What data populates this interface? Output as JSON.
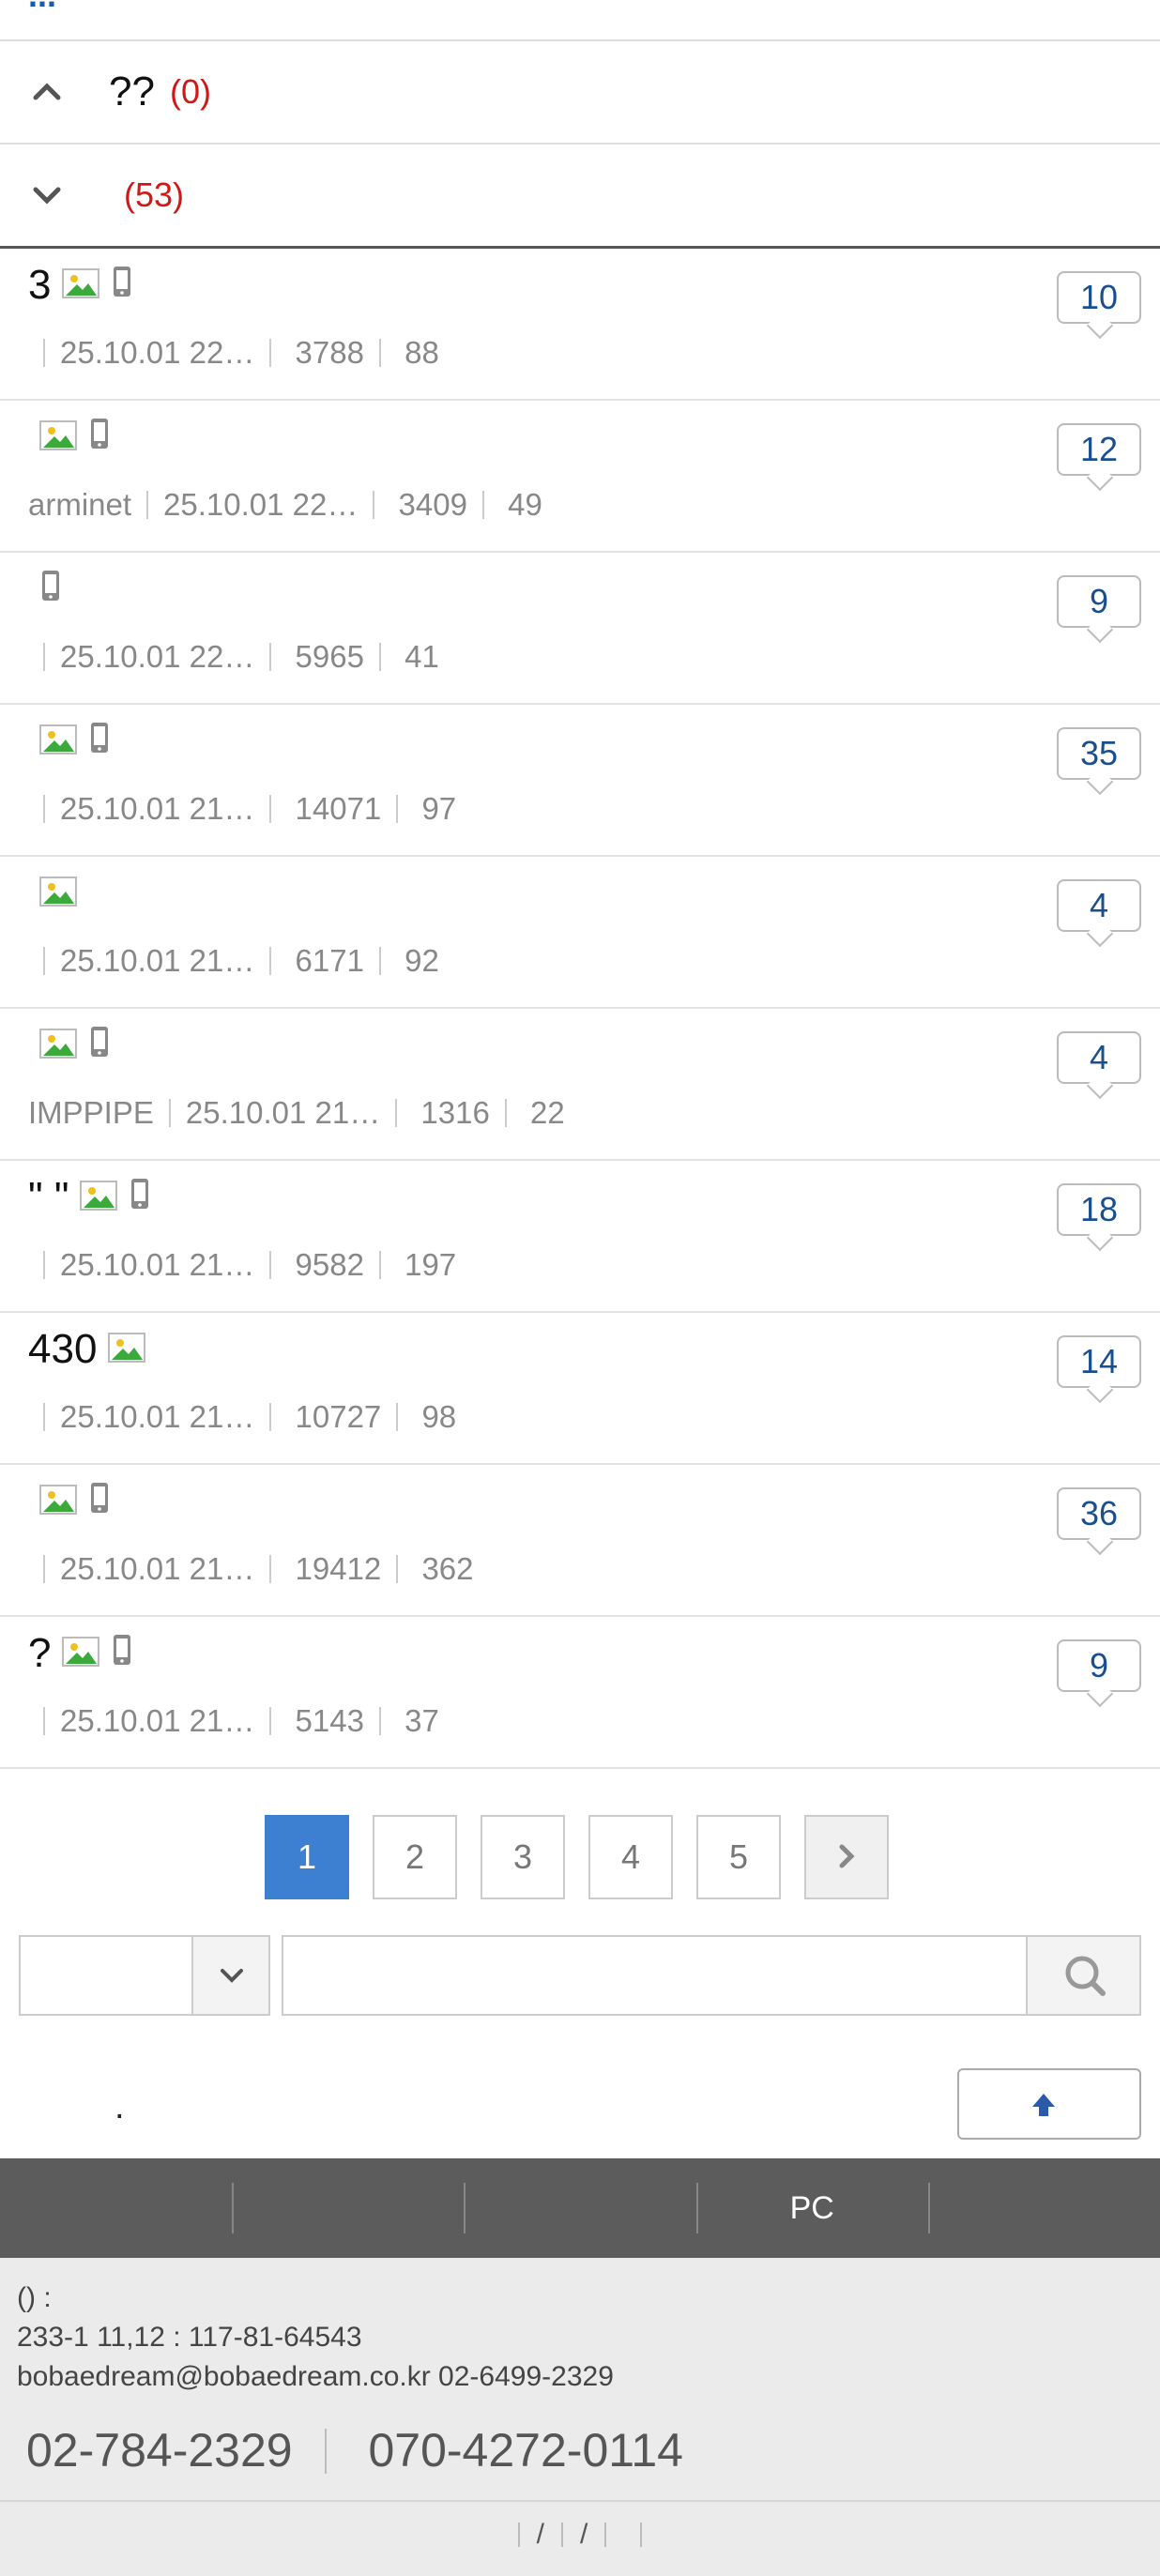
{
  "top_partial_text": "...",
  "parent_rows": [
    {
      "category": "",
      "title": "     ??",
      "count": "(0)",
      "expanded": true
    },
    {
      "category": "",
      "title": "   ",
      "count": "(53)",
      "expanded": false
    }
  ],
  "posts": [
    {
      "title": "   3     ",
      "icons": [
        "image-icon",
        "mobile-icon"
      ],
      "author": "",
      "date": "25.10.01  22…",
      "views": " 3788",
      "recommends": " 88",
      "replies": "10"
    },
    {
      "title": "   ",
      "icons": [
        "image-icon",
        "mobile-icon"
      ],
      "author": "arminet",
      "date": "25.10.01  22…",
      "views": " 3409",
      "recommends": " 49",
      "replies": "12"
    },
    {
      "title": " ",
      "icons": [
        "mobile-icon"
      ],
      "author": "",
      "date": "25.10.01  22…",
      "views": " 5965",
      "recommends": " 41",
      "replies": "9"
    },
    {
      "title": "   ",
      "icons": [
        "image-icon",
        "mobile-icon"
      ],
      "author": "",
      "date": "25.10.01  21…",
      "views": " 14071",
      "recommends": " 97",
      "replies": "35"
    },
    {
      "title": "  ",
      "icons": [
        "image-icon"
      ],
      "author": "",
      "date": "25.10.01  21…",
      "views": " 6171",
      "recommends": " 92",
      "replies": "4"
    },
    {
      "title": "  ",
      "icons": [
        "image-icon",
        "mobile-icon"
      ],
      "author": "IMPPIPE",
      "date": "25.10.01  21…",
      "views": " 1316",
      "recommends": " 22",
      "replies": "4"
    },
    {
      "title": "\"       \"",
      "icons": [
        "image-icon",
        "mobile-icon"
      ],
      "author": "",
      "date": "25.10.01  21…",
      "views": " 9582",
      "recommends": " 197",
      "replies": "18"
    },
    {
      "title": "   430",
      "icons": [
        "image-icon"
      ],
      "author": "",
      "date": "25.10.01  21…",
      "views": " 10727",
      "recommends": " 98",
      "replies": "14"
    },
    {
      "title": "    ",
      "icons": [
        "image-icon",
        "mobile-icon"
      ],
      "author": "",
      "date": "25.10.01  21…",
      "views": " 19412",
      "recommends": " 362",
      "replies": "36"
    },
    {
      "title": "  ?",
      "icons": [
        "image-icon",
        "mobile-icon"
      ],
      "author": "",
      "date": "25.10.01  21…",
      "views": " 5143",
      "recommends": " 37",
      "replies": "9"
    }
  ],
  "pagination": {
    "pages": [
      "1",
      "2",
      "3",
      "4",
      "5"
    ],
    "current": "1"
  },
  "search": {
    "select_value": "",
    "placeholder": "  "
  },
  "notice": {
    "label": "",
    "text": "   .",
    "top_button": ""
  },
  "footer_nav": [
    "",
    "",
    "",
    "PC",
    ""
  ],
  "footer_info": {
    "line1": "()  : ",
    "line2": "   233-1  11,12  : 117-81-64543",
    "line3": " bobaedream@bobaedream.co.kr      02-6499-2329",
    "phone1_label": "",
    "phone1": "02-784-2329",
    "phone2_label": "",
    "phone2": "070-4272-0114"
  },
  "footer_links": [
    "",
    "/",
    "/",
    "",
    ""
  ],
  "colors": {
    "accent_blue": "#3d7fd1",
    "count_red": "#d01818",
    "link_blue": "#1a5aa8",
    "footer_gray": "#5c5c5c"
  }
}
